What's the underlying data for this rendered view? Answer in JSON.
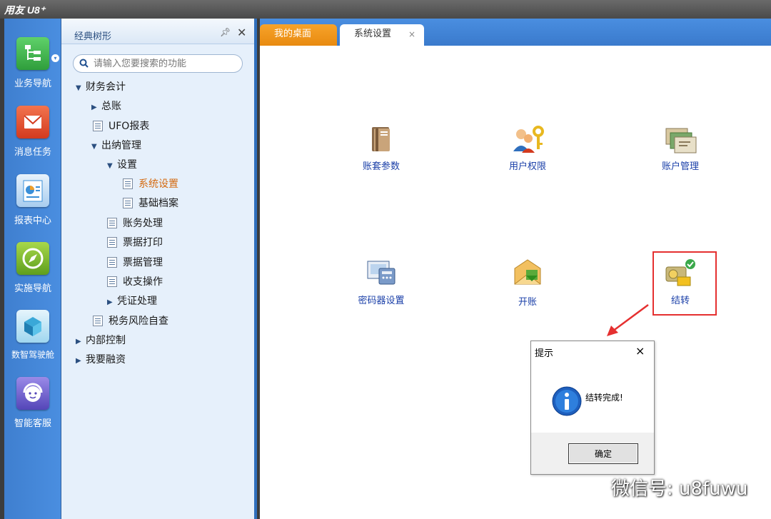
{
  "app": {
    "brand": "用友 U8⁺"
  },
  "leftnav": {
    "items": [
      {
        "label": "业务导航",
        "icon": "business-nav-icon",
        "color": "#3cb54a"
      },
      {
        "label": "消息任务",
        "icon": "message-task-icon",
        "color": "#e2452c"
      },
      {
        "label": "报表中心",
        "icon": "report-center-icon",
        "color": "#3a8fd8"
      },
      {
        "label": "实施导航",
        "icon": "compass-icon",
        "color": "#7ab530"
      },
      {
        "label": "数智驾驶舱",
        "icon": "cockpit-icon",
        "color": "#3aa8d8"
      },
      {
        "label": "智能客服",
        "icon": "customer-service-icon",
        "color": "#6a5ac8"
      }
    ]
  },
  "tree": {
    "title": "经典树形",
    "search_placeholder": "请输入您要搜索的功能",
    "nodes": [
      {
        "label": "财务会计"
      },
      {
        "label": "总账"
      },
      {
        "label": "UFO报表"
      },
      {
        "label": "出纳管理"
      },
      {
        "label": "设置"
      },
      {
        "label": "系统设置"
      },
      {
        "label": "基础档案"
      },
      {
        "label": "账务处理"
      },
      {
        "label": "票据打印"
      },
      {
        "label": "票据管理"
      },
      {
        "label": "收支操作"
      },
      {
        "label": "凭证处理"
      },
      {
        "label": "税务风险自查"
      },
      {
        "label": "内部控制"
      },
      {
        "label": "我要融资"
      }
    ]
  },
  "tabs": {
    "home": "我的桌面",
    "active": "系统设置",
    "close": "×"
  },
  "functions": [
    {
      "label": "账套参数",
      "icon": "account-set-params-icon"
    },
    {
      "label": "用户权限",
      "icon": "user-permission-icon"
    },
    {
      "label": "账户管理",
      "icon": "account-management-icon"
    },
    {
      "label": "密码器设置",
      "icon": "password-device-settings-icon"
    },
    {
      "label": "开账",
      "icon": "open-account-icon"
    },
    {
      "label": "结转",
      "icon": "carry-forward-icon"
    }
  ],
  "dialog": {
    "title": "提示",
    "message": "结转完成!",
    "ok": "确定",
    "close": "×"
  },
  "watermark": {
    "text": "微信号: u8fuwu"
  },
  "colors": {
    "accent": "#3a7acc",
    "home_tab": "#e88a10",
    "highlight": "#e53030",
    "link": "#1a3fa8"
  }
}
